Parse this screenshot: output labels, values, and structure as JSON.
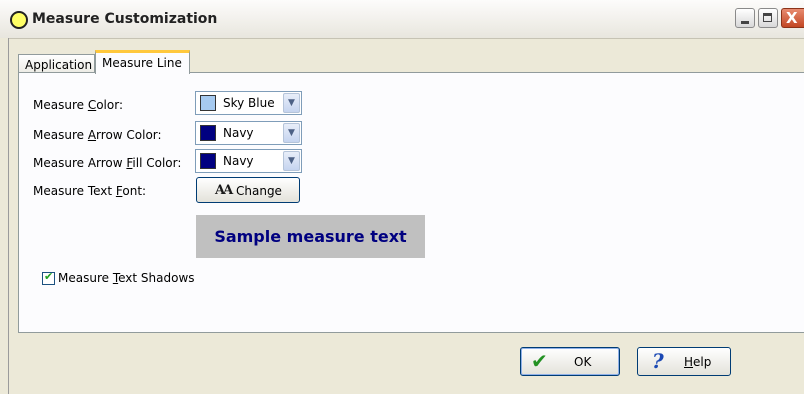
{
  "window": {
    "title": "Measure Customization",
    "minimize_glyph": "",
    "close_glyph": "X"
  },
  "tabs": [
    {
      "label": "Application",
      "active": false
    },
    {
      "label": "Measure Line",
      "active": true
    }
  ],
  "form": {
    "measure_color": {
      "label_pre": "Measure ",
      "label_u": "C",
      "label_post": "olor:",
      "value": "Sky Blue",
      "swatch": "#a6caf0"
    },
    "arrow_color": {
      "label_pre": "Measure ",
      "label_u": "A",
      "label_post": "rrow Color:",
      "value": "Navy",
      "swatch": "#000080"
    },
    "arrow_fill_color": {
      "label_pre": "Measure Arrow ",
      "label_u": "F",
      "label_post": "ill Color:",
      "value": "Navy",
      "swatch": "#000080"
    },
    "text_font": {
      "label_pre": "Measure Text ",
      "label_u": "F",
      "label_post": "ont:"
    },
    "change_button": {
      "icon_text": "AA",
      "label": "Change"
    },
    "sample_text": "Sample measure text",
    "shadows": {
      "label_pre": "Measure ",
      "label_u": "T",
      "label_post": "ext Shadows",
      "checked": true,
      "check_glyph": "✔"
    }
  },
  "buttons": {
    "ok": {
      "label": "OK",
      "icon": "✔"
    },
    "help": {
      "label_u": "H",
      "label_post": "elp",
      "icon": "?"
    }
  },
  "colors": {
    "sky_blue": "#a6caf0",
    "navy": "#000080",
    "sample_bg": "#c0c0c0"
  }
}
